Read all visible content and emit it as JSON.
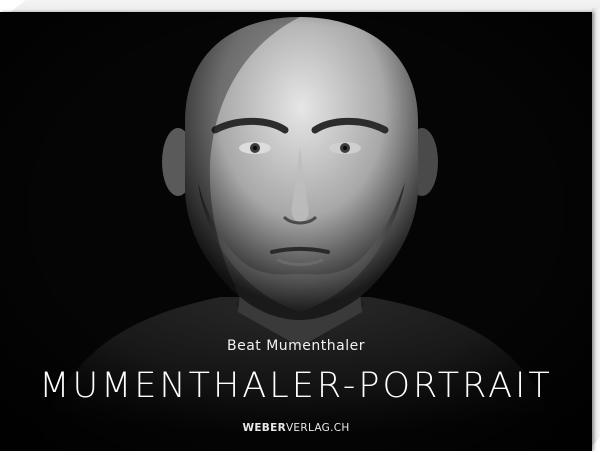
{
  "book": {
    "author": "Beat Mumenthaler",
    "title": "MUMENTHALER-PORTRAIT",
    "publisher_bold": "WEBER",
    "publisher_rest": "VERLAG.CH"
  },
  "cover_colors": {
    "background": "#050505",
    "text": "#ffffff"
  },
  "image": {
    "subject": "black-and-white portrait of a bald man with stubble beard"
  }
}
